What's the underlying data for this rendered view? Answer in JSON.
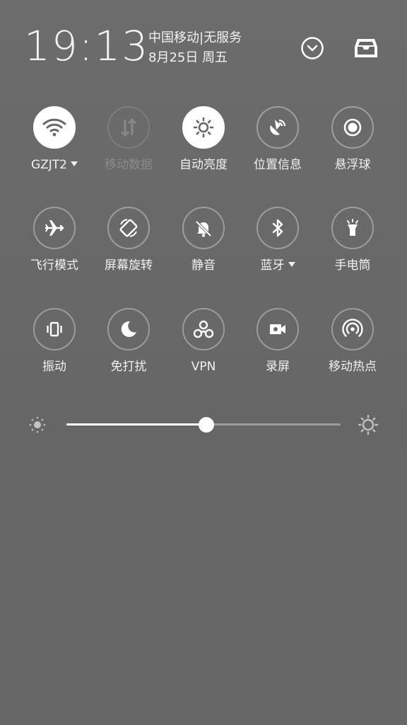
{
  "status": {
    "time": "19:13",
    "carrier": "中国移动|无服务",
    "date": "8月25日 周五"
  },
  "header_buttons": {
    "collapse_icon": "chevron-down-circle-icon",
    "notifications_icon": "inbox-tray-icon"
  },
  "tiles": [
    {
      "label": "GZJT2",
      "icon": "wifi-icon",
      "state": "on",
      "has_caret": true
    },
    {
      "label": "移动数据",
      "icon": "mobile-data-icon",
      "state": "disabled",
      "has_caret": false
    },
    {
      "label": "自动亮度",
      "icon": "brightness-icon",
      "state": "on",
      "has_caret": false
    },
    {
      "label": "位置信息",
      "icon": "location-icon",
      "state": "off",
      "has_caret": false
    },
    {
      "label": "悬浮球",
      "icon": "floating-ball-icon",
      "state": "off",
      "has_caret": false
    },
    {
      "label": "飞行模式",
      "icon": "airplane-icon",
      "state": "off",
      "has_caret": false
    },
    {
      "label": "屏幕旋转",
      "icon": "screen-rotation-icon",
      "state": "off",
      "has_caret": false
    },
    {
      "label": "静音",
      "icon": "mute-bell-icon",
      "state": "off",
      "has_caret": false
    },
    {
      "label": "蓝牙",
      "icon": "bluetooth-icon",
      "state": "off",
      "has_caret": true
    },
    {
      "label": "手电筒",
      "icon": "flashlight-icon",
      "state": "off",
      "has_caret": false
    },
    {
      "label": "振动",
      "icon": "vibrate-icon",
      "state": "off",
      "has_caret": false
    },
    {
      "label": "免打扰",
      "icon": "moon-icon",
      "state": "off",
      "has_caret": false
    },
    {
      "label": "VPN",
      "icon": "vpn-icon",
      "state": "off",
      "has_caret": false
    },
    {
      "label": "录屏",
      "icon": "screen-record-icon",
      "state": "off",
      "has_caret": false
    },
    {
      "label": "移动热点",
      "icon": "hotspot-icon",
      "state": "off",
      "has_caret": false
    }
  ],
  "brightness": {
    "level": 0.51,
    "low_icon": "brightness-low-icon",
    "high_icon": "brightness-high-icon"
  },
  "colors": {
    "background": "#676767",
    "tile_on": "#ffffff",
    "icon_on": "#676767",
    "icon_off": "#ffffff"
  }
}
